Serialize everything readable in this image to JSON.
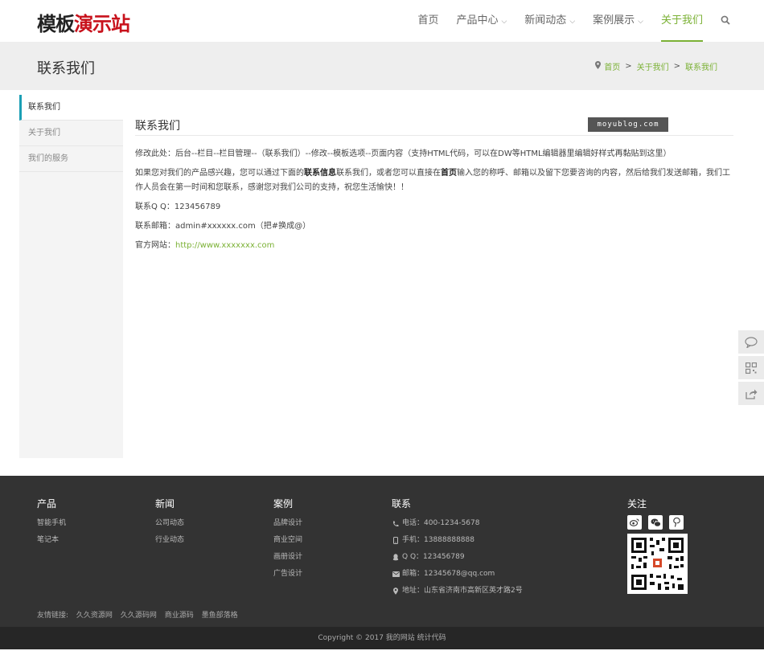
{
  "header": {
    "logo_part1": "模板",
    "logo_part2": "演示站",
    "nav": [
      {
        "label": "首页",
        "dropdown": false
      },
      {
        "label": "产品中心",
        "dropdown": true
      },
      {
        "label": "新闻动态",
        "dropdown": true
      },
      {
        "label": "案例展示",
        "dropdown": true
      },
      {
        "label": "关于我们",
        "dropdown": false,
        "active": true
      }
    ],
    "search_icon": "search-icon"
  },
  "banner": {
    "title": "联系我们",
    "breadcrumb": [
      "首页",
      "关于我们",
      "联系我们"
    ],
    "separator": ">"
  },
  "sidebar": {
    "items": [
      {
        "label": "联系我们",
        "active": true
      },
      {
        "label": "关于我们",
        "active": false
      },
      {
        "label": "我们的服务",
        "active": false
      }
    ]
  },
  "content": {
    "title": "联系我们",
    "watermark": "moyublog.com",
    "para1": "修改此处：后台--栏目--栏目管理--（联系我们）--修改--模板选项--页面内容（支持HTML代码，可以在DW等HTML编辑器里编辑好样式再黏贴到这里）",
    "para2_a": "如果您对我们的产品感兴趣，您可以通过下面的",
    "para2_b": "联系信息",
    "para2_c": "联系我们，或者您可以直接在",
    "para2_d": "首页",
    "para2_e": "输入您的称呼、邮箱以及留下您要咨询的内容，然后给我们发送邮箱，我们工作人员会在第一时间和您联系，感谢您对我们公司的支持，祝您生活愉快！！",
    "qq": "联系Q Q：123456789",
    "email": "联系邮箱：admin#xxxxxx.com（把#换成@）",
    "website_label": "官方网站：",
    "website_link": "http://www.xxxxxxx.com"
  },
  "floatbar": [
    "comment-icon",
    "qrcode-icon",
    "share-icon"
  ],
  "footer": {
    "products": {
      "title": "产品",
      "items": [
        "智能手机",
        "笔记本"
      ]
    },
    "news": {
      "title": "新闻",
      "items": [
        "公司动态",
        "行业动态"
      ]
    },
    "cases": {
      "title": "案例",
      "items": [
        "品牌设计",
        "商业空间",
        "画册设计",
        "广告设计"
      ]
    },
    "contact": {
      "title": "联系",
      "phone": "电话：400-1234-5678",
      "mobile": "手机：13888888888",
      "qq": "Q Q：123456789",
      "email": "邮箱：12345678@qq.com",
      "address": "地址：山东省济南市高新区英才路2号"
    },
    "follow": {
      "title": "关注",
      "icons": [
        "weibo-icon",
        "wechat-icon",
        "pinterest-icon"
      ]
    },
    "friends_label": "友情链接:",
    "friends": [
      "久久资源网",
      "久久源码网",
      "商业源码",
      "墨鱼部落格"
    ],
    "copyright": "Copyright © 2017 我的网站 统计代码"
  },
  "colors": {
    "accent": "#7bb135",
    "sidebar_active": "#1b9fb5",
    "logo_red": "#c8121c",
    "footer_bg": "#333333"
  }
}
